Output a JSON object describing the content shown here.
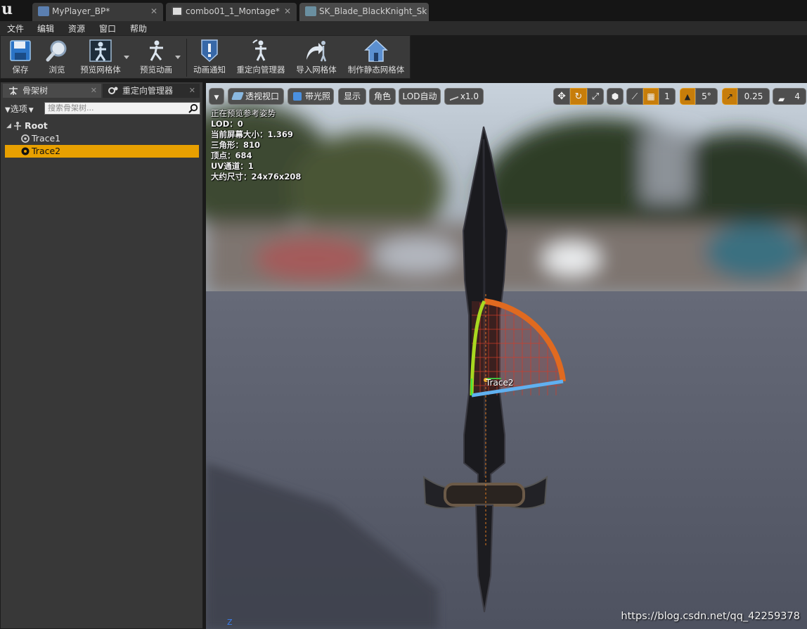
{
  "tabs": [
    {
      "label": "MyPlayer_BP*",
      "icon": "blueprint-icon"
    },
    {
      "label": "combo01_1_Montage*",
      "icon": "montage-icon"
    },
    {
      "label": "SK_Blade_BlackKnight_Sk",
      "icon": "skeleton-icon"
    }
  ],
  "menu": [
    "文件",
    "编辑",
    "资源",
    "窗口",
    "帮助"
  ],
  "toolbar": {
    "save": "保存",
    "browse": "浏览",
    "preview_mesh": "预览网格体",
    "preview_anim": "预览动画",
    "anim_notify": "动画通知",
    "retarget_mgr": "重定向管理器",
    "import_mesh": "导入网格体",
    "make_static_mesh": "制作静态网格体"
  },
  "left_panel": {
    "tab_skeleton_tree": "骨架树",
    "tab_retarget": "重定向管理器",
    "options": "选项",
    "search_placeholder": "搜索骨架树...",
    "tree": [
      {
        "label": "Root",
        "selected": false
      },
      {
        "label": "Trace1",
        "selected": false
      },
      {
        "label": "Trace2",
        "selected": true
      }
    ]
  },
  "viewport": {
    "perspective": "透视视口",
    "lit": "带光照",
    "show": "显示",
    "character": "角色",
    "lod": "LOD自动",
    "speed": "x1.0",
    "grid_value": "1",
    "rotate_snap": "5°",
    "scale_snap": "0.25",
    "camera_speed": "4",
    "stats": [
      "正在预览参考姿势",
      "LOD：0",
      "当前屏幕大小：1.369",
      "三角形：810",
      "顶点：684",
      "UV通道：1",
      "大约尺寸：24x76x208"
    ],
    "socket_label": "Trace2",
    "axis_label": "Z",
    "watermark": "https://blog.csdn.net/qq_42259378"
  },
  "colors": {
    "selection": "#e8a000",
    "snap_active": "#c77d0a"
  }
}
